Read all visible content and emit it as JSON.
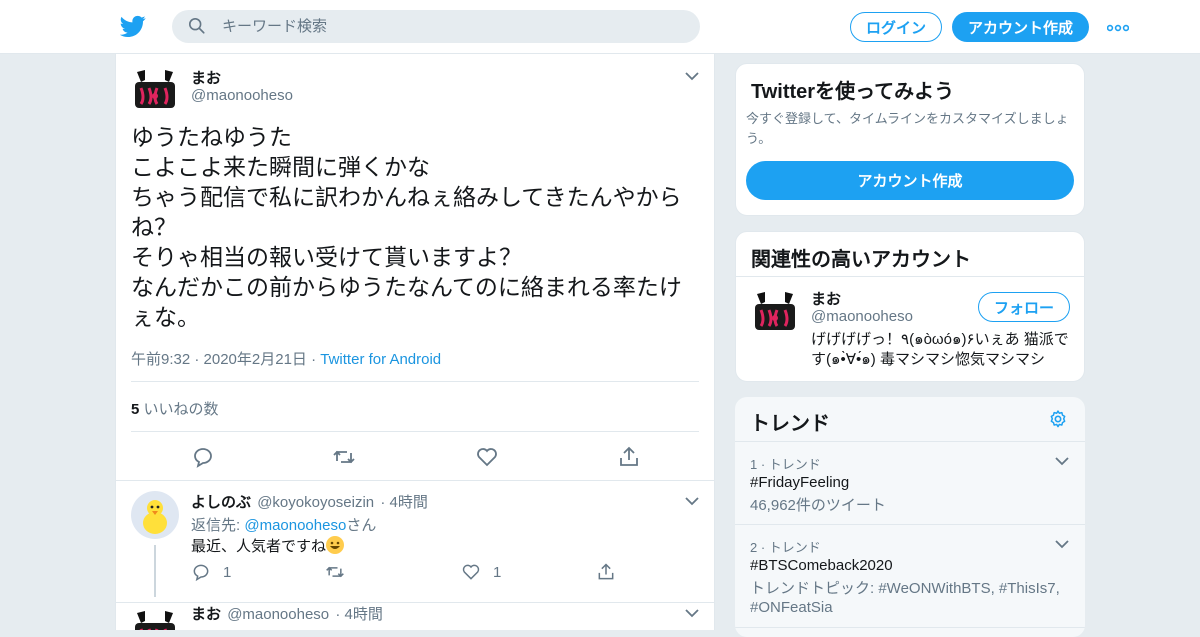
{
  "header": {
    "search_placeholder": "キーワード検索",
    "login_label": "ログイン",
    "signup_label": "アカウント作成",
    "accent": "#1da1f2"
  },
  "tweet": {
    "author_name": "まお",
    "author_handle": "@maonooheso",
    "text": "ゆうたねゆうた\nこよこよ来た瞬間に弾くかな\nちゃう配信で私に訳わかんねぇ絡みしてきたんやからね？\nそりゃ相当の報い受けて貰いますよ？\nなんだかこの前からゆうたなんてのに絡まれる率たけぇな。",
    "time": "午前9:32 · 2020年2月21日 · ",
    "source": "Twitter for Android",
    "likes_count": "5",
    "likes_label": "いいねの数"
  },
  "replies": [
    {
      "author_name": "よしのぶ",
      "author_handle": "@koyokoyoseizin",
      "time": "· 4時間",
      "reply_to_prefix": "返信先: ",
      "reply_to_handle": "@maonooheso",
      "reply_to_suffix": "さん",
      "text": "最近、人気者ですね",
      "reply_count": "1",
      "like_count": "1"
    },
    {
      "author_name": "まお",
      "author_handle": "@maonooheso",
      "time": "· 4時間"
    }
  ],
  "sidebar": {
    "signup_card": {
      "title": "Twitterを使ってみよう",
      "description": "今すぐ登録して、タイムラインをカスタマイズしましょう。",
      "button": "アカウント作成"
    },
    "related": {
      "title": "関連性の高いアカウント",
      "name": "まお",
      "handle": "@maonooheso",
      "follow_label": "フォロー",
      "bio": "げげげげっ！٩(๑òωó๑)۶いぇあ 猫派です(๑•̀∀•́๑) 毒マシマシ惚気マシマシ"
    },
    "trends": {
      "title": "トレンド",
      "items": [
        {
          "context": "1 · トレンド",
          "name": "#FridayFeeling",
          "sub": "46,962件のツイート"
        },
        {
          "context": "2 · トレンド",
          "name": "#BTSComeback2020",
          "sub": "トレンドトピック: #WeONWithBTS, #ThisIs7, #ONFeatSia"
        }
      ]
    }
  }
}
